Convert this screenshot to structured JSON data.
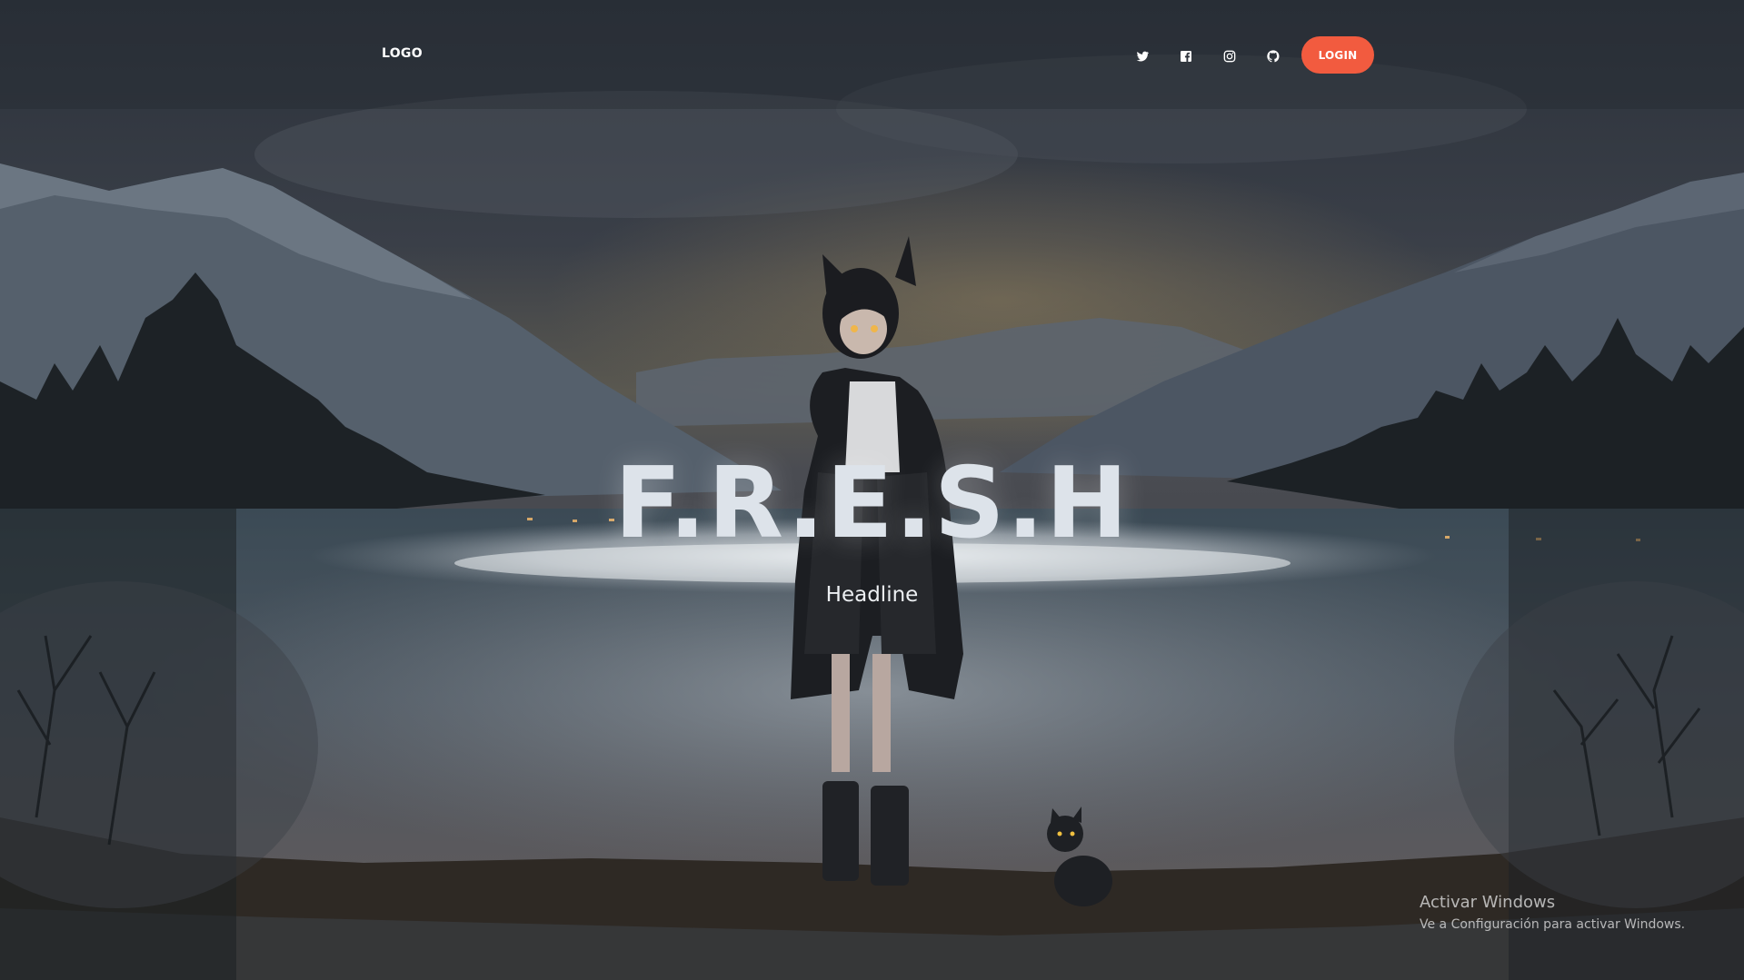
{
  "nav": {
    "logo": "LOGO",
    "social": [
      "twitter",
      "facebook",
      "instagram",
      "github"
    ],
    "login_label": "LOGIN"
  },
  "hero": {
    "title": "F.R.E.S.H",
    "subtitle": "Headline"
  },
  "watermark": {
    "title": "Activar Windows",
    "subtitle": "Ve a Configuración para activar Windows."
  },
  "colors": {
    "accent": "#f25b3f",
    "sky": "#3a3f4a",
    "text": "#ffffff"
  }
}
